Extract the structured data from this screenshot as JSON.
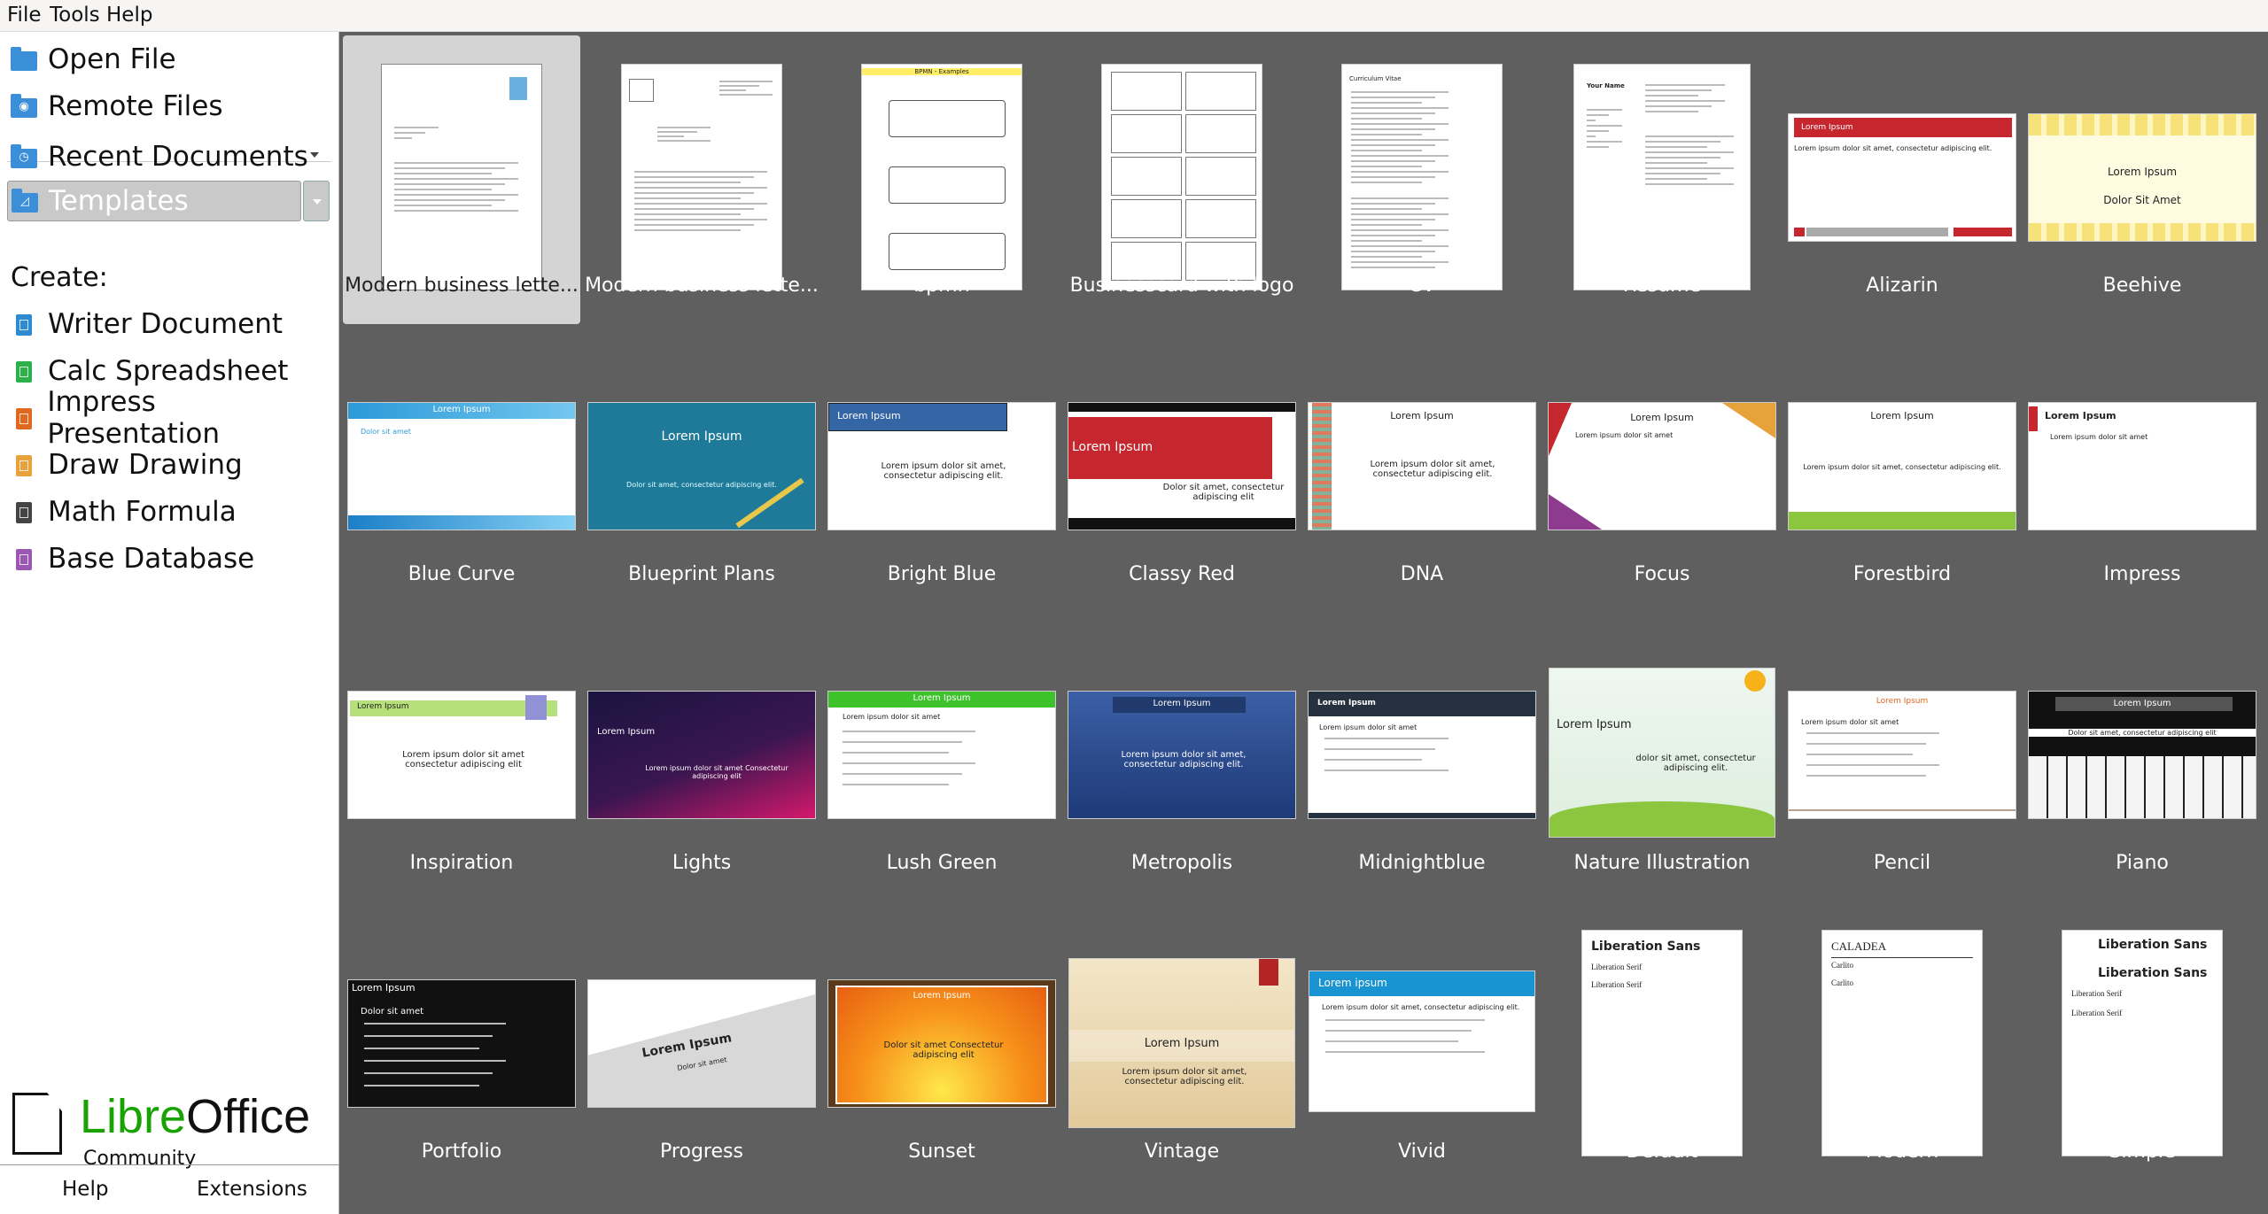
{
  "menubar": {
    "file": "File",
    "tools": "Tools",
    "help": "Help"
  },
  "sidebar": {
    "open_file": "Open File",
    "remote_files": "Remote Files",
    "recent_documents": "Recent Documents",
    "templates": "Templates",
    "create_label": "Create:",
    "create_items": [
      {
        "label": "Writer Document",
        "color": "#2c8bd3"
      },
      {
        "label": "Calc Spreadsheet",
        "color": "#2bb04a"
      },
      {
        "label": "Impress Presentation",
        "color": "#e0681f"
      },
      {
        "label": "Draw Drawing",
        "color": "#e8a23c"
      },
      {
        "label": "Math Formula",
        "color": "#444444"
      },
      {
        "label": "Base Database",
        "color": "#9a57b3"
      }
    ],
    "logo_libre": "Libre",
    "logo_office": "Office",
    "logo_community": "Community",
    "help": "Help",
    "extensions": "Extensions"
  },
  "templates": [
    {
      "label": "Modern business lette...",
      "kind": "letter",
      "selected": true
    },
    {
      "label": "Modern business lette...",
      "kind": "letter2"
    },
    {
      "label": "bpmn",
      "kind": "bpmn",
      "header": "BPMN - Examples"
    },
    {
      "label": "Businesscard with logo",
      "kind": "cards"
    },
    {
      "label": "CV",
      "kind": "cv",
      "header": "Curriculum Vitae"
    },
    {
      "label": "Resume",
      "kind": "resume",
      "header": "Your Name"
    },
    {
      "label": "Alizarin",
      "kind": "alizarin",
      "title": "Lorem Ipsum",
      "body": "Lorem ipsum dolor sit amet, consectetur adipiscing elit."
    },
    {
      "label": "Beehive",
      "kind": "beehive",
      "title": "Lorem Ipsum",
      "body": "Dolor Sit Amet"
    },
    {
      "label": "Blue Curve",
      "kind": "bluecurve",
      "title": "Lorem Ipsum",
      "body": "Dolor sit amet"
    },
    {
      "label": "Blueprint Plans",
      "kind": "blueprint",
      "title": "Lorem Ipsum",
      "body": "Dolor sit amet, consectetur adipiscing elit."
    },
    {
      "label": "Bright Blue",
      "kind": "brightblue",
      "title": "Lorem Ipsum",
      "body": "Lorem ipsum dolor sit amet, consectetur adipiscing elit."
    },
    {
      "label": "Classy Red",
      "kind": "classyred",
      "title": "Lorem Ipsum",
      "body": "Dolor sit amet, consectetur adipiscing elit"
    },
    {
      "label": "DNA",
      "kind": "dna",
      "title": "Lorem Ipsum",
      "body": "Lorem ipsum dolor sit amet, consectetur adipiscing elit."
    },
    {
      "label": "Focus",
      "kind": "focus",
      "title": "Lorem Ipsum",
      "body": "Lorem ipsum dolor sit amet"
    },
    {
      "label": "Forestbird",
      "kind": "forestbird",
      "title": "Lorem Ipsum",
      "body": "Lorem ipsum dolor sit amet, consectetur adipiscing elit."
    },
    {
      "label": "Impress",
      "kind": "impress",
      "title": "Lorem Ipsum",
      "body": "Lorem ipsum dolor sit amet"
    },
    {
      "label": "Inspiration",
      "kind": "inspiration",
      "title": "Lorem Ipsum",
      "body": "Lorem ipsum dolor sit amet consectetur adipiscing elit"
    },
    {
      "label": "Lights",
      "kind": "lights",
      "title": "Lorem Ipsum",
      "body": "Lorem ipsum dolor sit amet Consectetur adipiscing elit"
    },
    {
      "label": "Lush Green",
      "kind": "lushgreen",
      "title": "Lorem Ipsum",
      "body": "Lorem ipsum dolor sit amet"
    },
    {
      "label": "Metropolis",
      "kind": "metropolis",
      "title": "Lorem Ipsum",
      "body": "Lorem ipsum dolor sit amet, consectetur adipiscing elit."
    },
    {
      "label": "Midnightblue",
      "kind": "midnightblue",
      "title": "Lorem Ipsum",
      "body": "Lorem ipsum dolor sit amet"
    },
    {
      "label": "Nature Illustration",
      "kind": "nature",
      "title": "Lorem Ipsum",
      "body": "dolor sit amet, consectetur adipiscing elit."
    },
    {
      "label": "Pencil",
      "kind": "pencil",
      "title": "Lorem Ipsum",
      "body": "Lorem ipsum dolor sit amet"
    },
    {
      "label": "Piano",
      "kind": "piano",
      "title": "Lorem Ipsum",
      "body": "Dolor sit amet, consectetur adipiscing elit"
    },
    {
      "label": "Portfolio",
      "kind": "portfolio",
      "title": "Lorem Ipsum",
      "body": "Dolor sit amet"
    },
    {
      "label": "Progress",
      "kind": "progress",
      "title": "Lorem Ipsum",
      "body": "Dolor sit amet"
    },
    {
      "label": "Sunset",
      "kind": "sunset",
      "title": "Lorem Ipsum",
      "body": "Dolor sit amet Consectetur adipiscing elit"
    },
    {
      "label": "Vintage",
      "kind": "vintage",
      "title": "Lorem Ipsum",
      "body": "Lorem ipsum dolor sit amet, consectetur adipiscing elit."
    },
    {
      "label": "Vivid",
      "kind": "vivid",
      "title": "Lorem ipsum",
      "body": "Lorem ipsum dolor sit amet, consectetur adipiscing elit."
    },
    {
      "label": "Default",
      "kind": "default",
      "title": "Liberation Sans",
      "body": "Liberation Serif"
    },
    {
      "label": "Modern",
      "kind": "modern",
      "title": "CALADEA",
      "body": "Carlito"
    },
    {
      "label": "Simple",
      "kind": "simple",
      "title": "Liberation Sans",
      "body": "Liberation Serif"
    }
  ]
}
